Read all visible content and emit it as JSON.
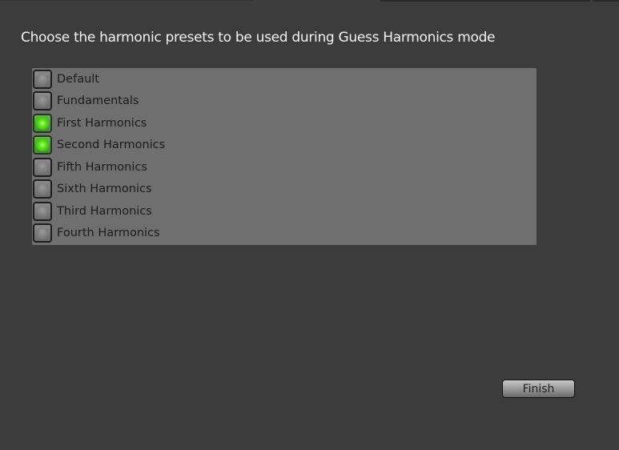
{
  "dialog": {
    "title": "Choose the harmonic presets to be used during Guess Harmonics mode"
  },
  "presets": [
    {
      "label": "Default",
      "checked": false
    },
    {
      "label": "Fundamentals",
      "checked": false
    },
    {
      "label": "First Harmonics",
      "checked": true
    },
    {
      "label": "Second Harmonics",
      "checked": true
    },
    {
      "label": "Fifth Harmonics",
      "checked": false
    },
    {
      "label": "Sixth Harmonics",
      "checked": false
    },
    {
      "label": "Third Harmonics",
      "checked": false
    },
    {
      "label": "Fourth Harmonics",
      "checked": false
    }
  ],
  "buttons": {
    "finish_label": "Finish"
  },
  "colors": {
    "background": "#3c3c3c",
    "panel": "#6f6f6f",
    "checked_indicator": "#5fe61e"
  }
}
